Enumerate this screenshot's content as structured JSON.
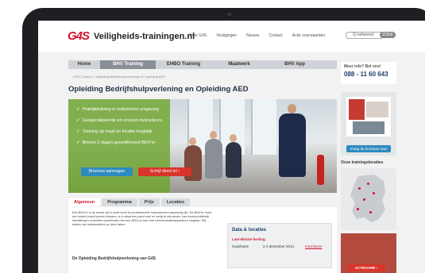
{
  "site": {
    "logo": "G4S",
    "name": "Veiligheids-trainingen.nl"
  },
  "toplinks": [
    "Over G4S",
    "Vestigingen",
    "Nieuws",
    "Contact",
    "Actie voorwaarden"
  ],
  "search": {
    "placeholder": "Q trefwoord",
    "button": "ZOEK"
  },
  "nav": [
    "Home",
    "BHV Training",
    "EHBO Training",
    "Maatwerk",
    "BHV App"
  ],
  "breadcrumb": "BHV Cursus  >  Opleiding Bedrijfshulpverlening en Opleiding AED",
  "page_title": "Opleiding Bedrijfshulpverlening en Opleiding AED",
  "hero": {
    "bullets": [
      "Praktijktraining in realistische omgeving",
      "Gespecialiseerde en ervaren instructeurs",
      "Training op maat en locatie mogelijk",
      "Binnen 2 dagen gecertificeerd BHV'er"
    ],
    "btn_brochure": "Brochure aanvragen",
    "btn_enroll": "Schrijf direct in!  ›"
  },
  "tabs": [
    "Algemeen",
    "Programma",
    "Prijs",
    "Locaties"
  ],
  "content": {
    "paragraph": "Een BHV'er is de eerste die in actie komt tot professionele hulpverleners aanwezig zijn. De BHV'er moet een kleine brand kunnen blussen, is in staat een pand snel en veilig te ontruimen, kan levensreddende handelingen verrichten (reanimatie met een AED) en kan met communicatieapparatuur omgaan. Wij trainen uw medewerkers op deze taken.",
    "subhead": "De Opleiding Bedrijfshulpverlening van G4S"
  },
  "dates": {
    "title": "Data & locaties",
    "lastminute": "Last-Minute korting",
    "place": "Oudeharie",
    "date": "2-3 december 2013",
    "link": "Inschrijven"
  },
  "sidebar": {
    "meer_info": "Meer info? Bel ons!",
    "phone": "088 - 11 60 643",
    "brochure_btn": "Vraag de brochure aan!",
    "locaties_title": "Onze trainingslocaties",
    "promo_btn": "ACTIEVARE ›"
  },
  "colors": {
    "brand_red": "#d3142b",
    "brand_blue": "#1a3f6f",
    "hero_green": "#6ea52d",
    "button_blue": "#2e8bc0"
  }
}
